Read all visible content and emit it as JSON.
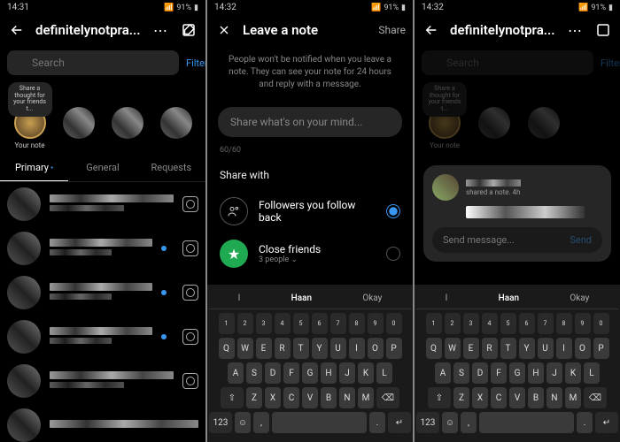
{
  "status": {
    "time1": "14:31",
    "time2": "14:32",
    "battery": "91%"
  },
  "screen1": {
    "title": "definitelynotpra...",
    "search_placeholder": "Search",
    "filter_label": "Filter",
    "your_note_bubble": "Share a thought for your friends t...",
    "your_note_label": "Your note",
    "tabs": {
      "primary": "Primary",
      "general": "General",
      "requests": "Requests"
    }
  },
  "screen2": {
    "title": "Leave a note",
    "share_label": "Share",
    "info": "People won't be notified when you leave a note. They can see your note for 24 hours and reply with a message.",
    "input_placeholder": "Share what's on your mind...",
    "char_count": "60/60",
    "share_with_label": "Share with",
    "options": {
      "followers": "Followers you follow back",
      "close_friends": "Close friends",
      "close_friends_sub": "3 people"
    }
  },
  "screen3": {
    "title": "definitelynotpra...",
    "note_meta": "shared a note. 4h",
    "reply_placeholder": "Send message...",
    "send_label": "Send"
  },
  "keyboard": {
    "suggest": [
      "I",
      "Haan",
      "Okay"
    ],
    "num_row": [
      "1",
      "2",
      "3",
      "4",
      "5",
      "6",
      "7",
      "8",
      "9",
      "0"
    ],
    "row1": [
      "Q",
      "W",
      "E",
      "R",
      "T",
      "Y",
      "U",
      "I",
      "O",
      "P"
    ],
    "row2": [
      "A",
      "S",
      "D",
      "F",
      "G",
      "H",
      "J",
      "K",
      "L"
    ],
    "row3": [
      "Z",
      "X",
      "C",
      "V",
      "B",
      "N",
      "M"
    ],
    "key_123": "123"
  }
}
